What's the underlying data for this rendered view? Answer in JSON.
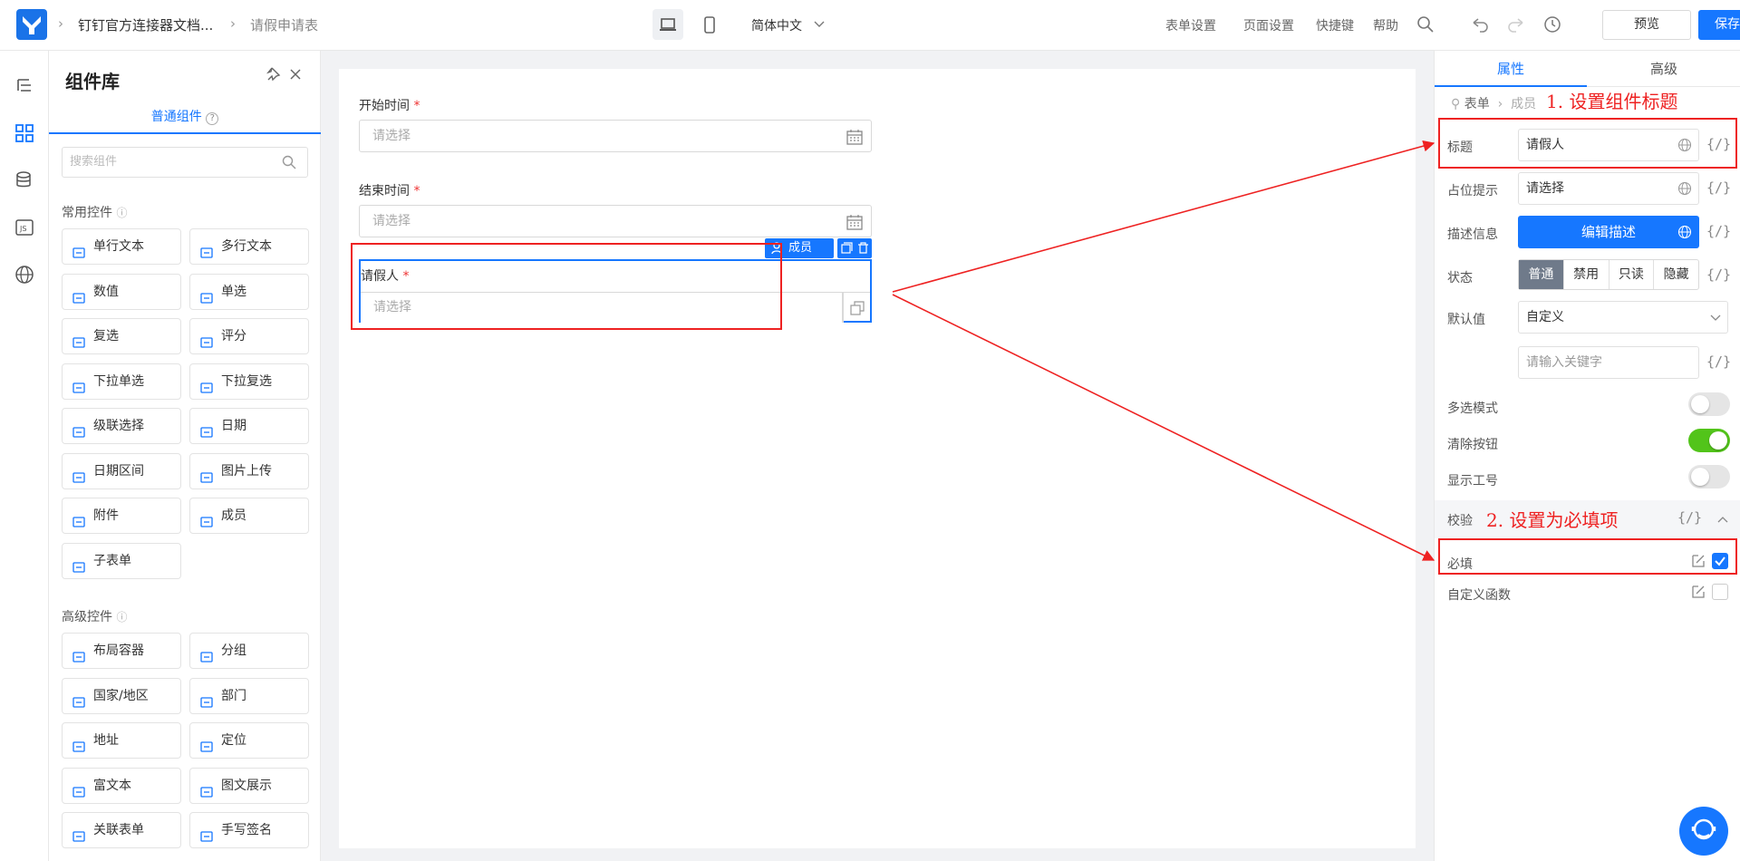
{
  "header": {
    "app_name": "钉钉官方连接器文档...",
    "page_name": "请假申请表",
    "language": "简体中文",
    "menu": [
      "表单设置",
      "页面设置",
      "快捷键",
      "帮助"
    ],
    "preview_label": "预览",
    "save_label": "保存"
  },
  "library": {
    "title": "组件库",
    "tab": "普通组件",
    "search_placeholder": "搜索组件",
    "common_title": "常用控件",
    "common": [
      "单行文本",
      "多行文本",
      "数值",
      "单选",
      "复选",
      "评分",
      "下拉单选",
      "下拉复选",
      "级联选择",
      "日期",
      "日期区间",
      "图片上传",
      "附件",
      "成员",
      "子表单"
    ],
    "advanced_title": "高级控件",
    "advanced": [
      "布局容器",
      "分组",
      "国家/地区",
      "部门",
      "地址",
      "定位",
      "富文本",
      "图文展示",
      "关联表单",
      "手写签名"
    ]
  },
  "form": {
    "fields": [
      {
        "label": "开始时间",
        "placeholder": "请选择"
      },
      {
        "label": "结束时间",
        "placeholder": "请选择"
      },
      {
        "label": "请假人",
        "placeholder": "请选择"
      }
    ],
    "selected_tag": "成员"
  },
  "props": {
    "tabs": [
      "属性",
      "高级"
    ],
    "breadcrumb": [
      "表单",
      "成员"
    ],
    "title_label": "标题",
    "title_value": "请假人",
    "placeholder_label": "占位提示",
    "placeholder_value": "请选择",
    "desc_label": "描述信息",
    "desc_button": "编辑描述",
    "state_label": "状态",
    "states": [
      "普通",
      "禁用",
      "只读",
      "隐藏"
    ],
    "default_label": "默认值",
    "default_value": "自定义",
    "keyword_placeholder": "请输入关键字",
    "multi_label": "多选模式",
    "clear_label": "清除按钮",
    "empno_label": "显示工号",
    "validate_label": "校验",
    "required_label": "必填",
    "custom_fn_label": "自定义函数",
    "brace": "{/}",
    "multi_on": false,
    "clear_on": true,
    "empno_on": false,
    "required_checked": true
  },
  "annotations": {
    "a1": "1. 设置组件标题",
    "a2": "2. 设置为必填项"
  },
  "colors": {
    "accent": "#1677ff",
    "annotation": "#e22222",
    "toggle_on": "#52c41a"
  }
}
